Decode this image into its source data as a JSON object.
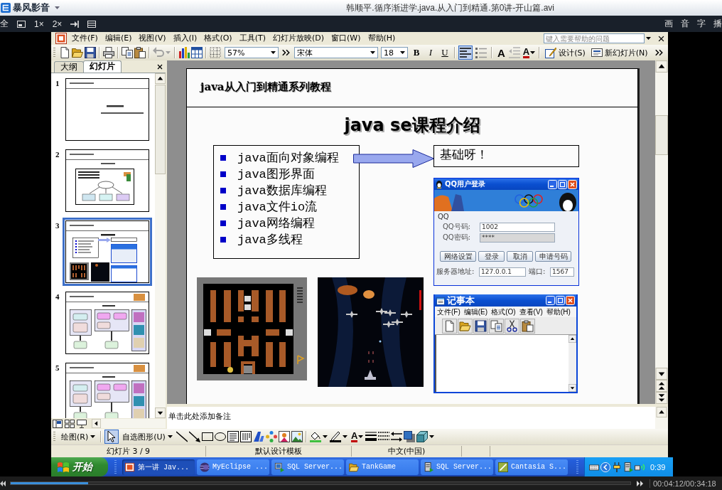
{
  "player": {
    "app_name": "暴风影音",
    "title": "韩顺平.循序渐进学.java.从入门到精通.第0讲-开山篇.avi",
    "view_controls": [
      "全",
      "1×",
      "2×"
    ],
    "panel_buttons": [
      "画",
      "音",
      "字",
      "播"
    ]
  },
  "powerpoint": {
    "menu": [
      "文件(F)",
      "编辑(E)",
      "视图(V)",
      "插入(I)",
      "格式(O)",
      "工具(T)",
      "幻灯片放映(D)",
      "窗口(W)",
      "帮助(H)"
    ],
    "help_search": {
      "placeholder": "键入需要帮助的问题"
    },
    "toolbar": {
      "zoom": "57%",
      "font": "宋体",
      "font_size": "18",
      "style_buttons": [
        {
          "label": "B",
          "selected": false
        },
        {
          "label": "I",
          "selected": false
        },
        {
          "label": "U",
          "selected": false
        }
      ],
      "paragraph_buttons": [
        {
          "selected": true
        },
        {
          "selected": false
        }
      ],
      "grow_font": "A",
      "font_color": "A",
      "design": "设计(S)",
      "new_slide": "新幻灯片(N)"
    },
    "outline_pane": {
      "tabs": [
        {
          "label": "大纲",
          "selected": false
        },
        {
          "label": "幻灯片",
          "selected": true
        }
      ],
      "slides": [
        {
          "number": "1",
          "kind": "title",
          "selected": false
        },
        {
          "number": "2",
          "kind": "diagram",
          "selected": false
        },
        {
          "number": "3",
          "kind": "overview",
          "selected": true
        },
        {
          "number": "4",
          "kind": "boxes",
          "selected": false
        },
        {
          "number": "5",
          "kind": "boxes",
          "selected": false
        }
      ]
    },
    "slide": {
      "header": "java从入门到精通系列教程",
      "title": "java se课程介绍",
      "bullets": [
        "java面向对象编程",
        "java图形界面",
        "java数据库编程",
        "java文件io流",
        "java网络编程",
        "java多线程"
      ],
      "callout": "基础呀！",
      "qq_login": {
        "title": "QQ用户登录",
        "group": "QQ",
        "fields": [
          {
            "label": "QQ号码:",
            "value": "1002",
            "kind": "text"
          },
          {
            "label": "QQ密码:",
            "value": "****",
            "kind": "password"
          }
        ],
        "buttons": [
          "网络设置",
          "登录",
          "取消",
          "申请号码"
        ],
        "server_label": "服务器地址:",
        "server": "127.0.0.1",
        "port_label": "端口:",
        "port": "1567"
      },
      "notepad": {
        "title": "记事本",
        "menu": [
          "文件(F)",
          "编辑(E)",
          "格式(O)",
          "查看(V)",
          "帮助(H)"
        ]
      }
    },
    "notes": {
      "placeholder": "单击此处添加备注"
    },
    "drawing_toolbar": {
      "draw": "绘图(R)",
      "select_tool": {
        "selected": true
      },
      "autoshapes": "自选图形(U)",
      "font_color": "A"
    },
    "status_bar": [
      "幻灯片 3 / 9",
      "默认设计模板",
      "中文(中国)"
    ]
  },
  "taskbar": {
    "start": "开始",
    "tasks": [
      {
        "label": "第一讲 Jav...",
        "selected": true
      },
      {
        "label": "MyEclipse ...",
        "selected": false
      },
      {
        "label": "SQL Server...",
        "selected": false
      },
      {
        "label": "TankGame",
        "selected": false
      },
      {
        "label": "SQL Server...",
        "selected": false
      },
      {
        "label": "Cantasia S...",
        "selected": false
      }
    ],
    "clock": "0:39"
  },
  "playback": {
    "progress": {
      "level": 0.125
    },
    "time": "00:04:12/00:34:18"
  }
}
